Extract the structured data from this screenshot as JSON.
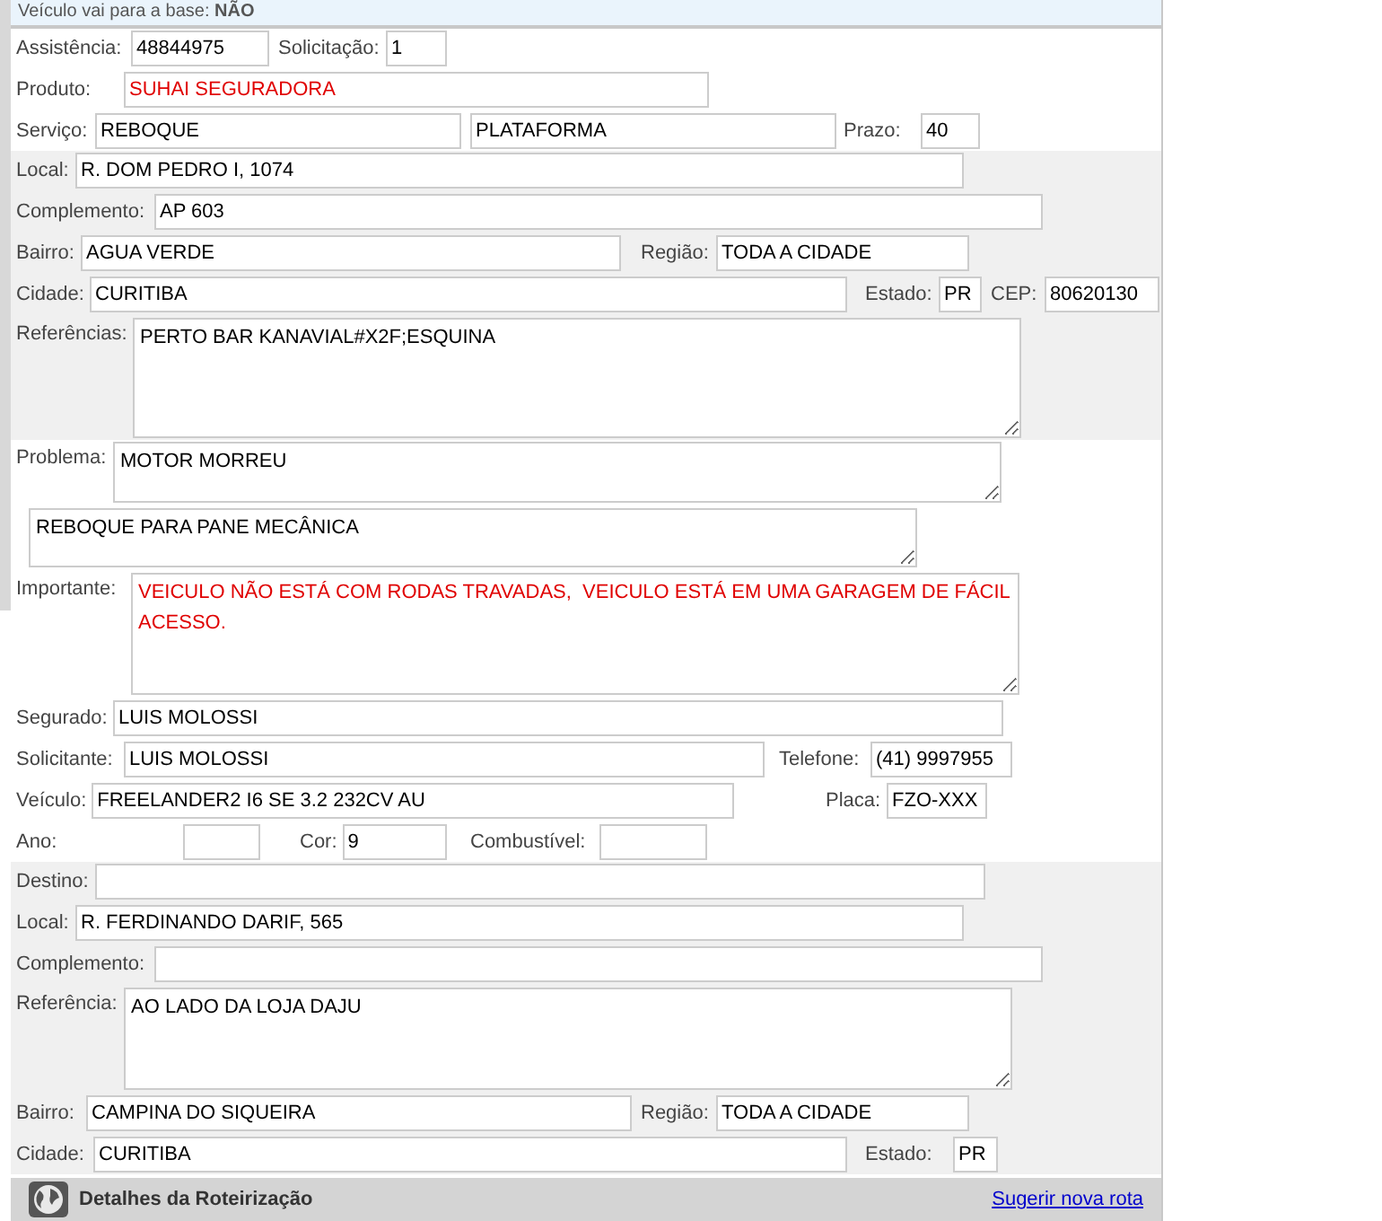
{
  "banner": "Veículo vai para a base: **NÃO**",
  "sections": [
    {
      "shaded": false,
      "rows": [
        [
          {
            "label": "Assistência:",
            "value": "48844975",
            "kind": "input",
            "alert": false
          },
          {
            "label": "Solicitação:",
            "value": "1",
            "kind": "input",
            "alert": false
          }
        ],
        [
          {
            "label": "Produto:",
            "value": "SUHAI SEGURADORA",
            "kind": "input",
            "alert": true
          }
        ],
        [
          {
            "label": "Serviço:",
            "value": "REBOQUE",
            "kind": "input",
            "alert": false
          },
          {
            "value": "PLATAFORMA",
            "kind": "input",
            "alert": false
          },
          {
            "label": "Prazo:",
            "value": "40",
            "kind": "input",
            "alert": false
          }
        ]
      ]
    },
    {
      "shaded": true,
      "rows": [
        [
          {
            "label": "Local:",
            "value": "R. DOM PEDRO I, 1074",
            "kind": "input",
            "alert": false
          }
        ],
        [
          {
            "label": "Complemento:",
            "value": "AP 603",
            "kind": "input",
            "alert": false
          }
        ],
        [
          {
            "label": "Bairro:",
            "value": "AGUA VERDE",
            "kind": "input",
            "alert": false
          },
          {
            "label": "Região:",
            "value": "TODA A CIDADE",
            "kind": "input",
            "alert": false
          }
        ],
        [
          {
            "label": "Cidade:",
            "value": "CURITIBA",
            "kind": "input",
            "alert": false
          },
          {
            "label": "Estado:",
            "value": "PR",
            "kind": "input",
            "alert": false
          },
          {
            "label": "CEP:",
            "value": "80620130",
            "kind": "input",
            "alert": false
          }
        ],
        [
          {
            "label": "Referências:",
            "value": "PERTO BAR KANAVIAL#X2F;ESQUINA",
            "kind": "textarea",
            "alert": false
          }
        ]
      ]
    },
    {
      "shaded": false,
      "rows": [
        [
          {
            "label": "Problema:",
            "value": "MOTOR MORREU",
            "kind": "textarea",
            "alert": false
          }
        ],
        [
          {
            "value": "REBOQUE PARA PANE MECÂNICA",
            "kind": "textarea",
            "alert": false
          }
        ],
        [
          {
            "label": "Importante:",
            "value": "VEICULO NÃO ESTÁ COM RODAS TRAVADAS,  VEICULO ESTÁ EM UMA GARAGEM DE FÁCIL ACESSO.",
            "kind": "textarea",
            "alert": true
          }
        ],
        [
          {
            "label": "Segurado:",
            "value": "LUIS MOLOSSI",
            "kind": "input",
            "alert": false
          }
        ],
        [
          {
            "label": "Solicitante:",
            "value": "LUIS MOLOSSI",
            "kind": "input",
            "alert": false
          },
          {
            "label": "Telefone:",
            "value": "(41) 9997955",
            "kind": "input",
            "alert": false
          }
        ],
        [
          {
            "label": "Veículo:",
            "value": "FREELANDER2 I6 SE 3.2 232CV AU",
            "kind": "input",
            "alert": false
          },
          {
            "label": "Placa:",
            "value": "FZO-XXX",
            "kind": "input",
            "alert": false
          }
        ],
        [
          {
            "label": "Ano:",
            "kind": "input"
          },
          {
            "label": "Cor:",
            "value": "9",
            "kind": "input",
            "alert": false
          },
          {
            "label": "Combustível:",
            "kind": "input"
          }
        ]
      ]
    },
    {
      "shaded": true,
      "rows": [
        [
          {
            "label": "Destino:",
            "kind": "input"
          }
        ],
        [
          {
            "label": "Local:",
            "value": "R. FERDINANDO DARIF, 565",
            "kind": "input",
            "alert": false
          }
        ],
        [
          {
            "label": "Complemento:",
            "kind": "input"
          }
        ],
        [
          {
            "label": "Referência:",
            "value": "AO LADO DA LOJA DAJU",
            "kind": "textarea",
            "alert": false
          }
        ],
        [
          {
            "label": "Bairro:",
            "value": "CAMPINA DO SIQUEIRA",
            "kind": "input",
            "alert": false
          },
          {
            "label": "Região:",
            "value": "TODA A CIDADE",
            "kind": "input",
            "alert": false
          }
        ],
        [
          {
            "label": "Cidade:",
            "value": "CURITIBA",
            "kind": "input",
            "alert": false
          },
          {
            "label": "Estado:",
            "value": "PR",
            "kind": "input",
            "alert": false
          }
        ]
      ]
    }
  ],
  "footer": {
    "title": "Detalhes da Roteirização",
    "link": "Sugerir nova rota"
  }
}
